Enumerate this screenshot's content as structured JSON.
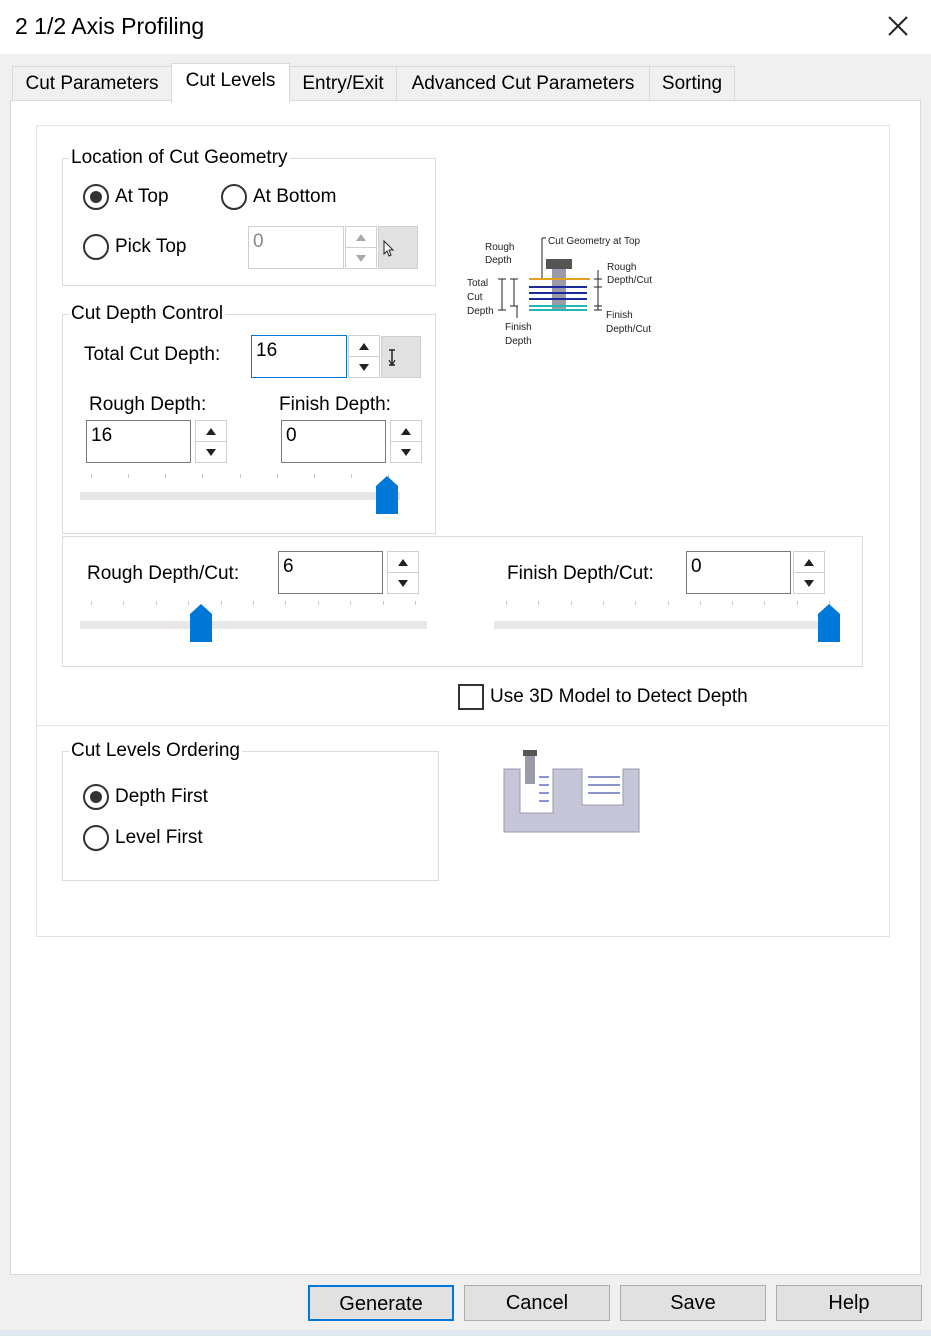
{
  "window": {
    "title": "2 1/2 Axis Profiling",
    "close_label": "×"
  },
  "tabs": [
    {
      "label": "Cut Parameters"
    },
    {
      "label": "Cut Levels"
    },
    {
      "label": "Entry/Exit"
    },
    {
      "label": "Advanced Cut Parameters"
    },
    {
      "label": "Sorting"
    }
  ],
  "active_tab": "Cut Levels",
  "location_group": {
    "title": "Location of Cut Geometry",
    "at_top": {
      "label": "At Top",
      "selected": true
    },
    "at_bottom": {
      "label": "At Bottom",
      "selected": false
    },
    "pick_top": {
      "label": "Pick Top",
      "selected": false
    },
    "pick_top_value": "0"
  },
  "depth_group": {
    "title": "Cut Depth Control",
    "total_label": "Total Cut Depth:",
    "total_value": "16",
    "rough_label": "Rough Depth:",
    "rough_value": "16",
    "finish_label": "Finish Depth:",
    "finish_value": "0",
    "depth_slider_position": 1.0
  },
  "per_cut_group": {
    "rough_label": "Rough Depth/Cut:",
    "rough_value": "6",
    "rough_slider_position": 0.34,
    "finish_label": "Finish Depth/Cut:",
    "finish_value": "0",
    "finish_slider_position": 1.0
  },
  "use_3d": {
    "label": "Use 3D Model to Detect Depth",
    "checked": false
  },
  "diagram": {
    "rough_depth": "Rough",
    "rough_depth_2": "Depth",
    "cut_geometry": "Cut Geometry at Top",
    "total": "Total",
    "cut": "Cut",
    "depth": "Depth",
    "rough_per_cut": "Rough",
    "rough_per_cut_2": "Depth/Cut",
    "finish_depth": "Finish",
    "finish_depth_2": "Depth",
    "finish_per_cut": "Finish",
    "finish_per_cut_2": "Depth/Cut"
  },
  "ordering_group": {
    "title": "Cut Levels Ordering",
    "depth_first": {
      "label": "Depth First",
      "selected": true
    },
    "level_first": {
      "label": "Level First",
      "selected": false
    }
  },
  "buttons": {
    "generate": "Generate",
    "cancel": "Cancel",
    "save": "Save",
    "help": "Help"
  }
}
